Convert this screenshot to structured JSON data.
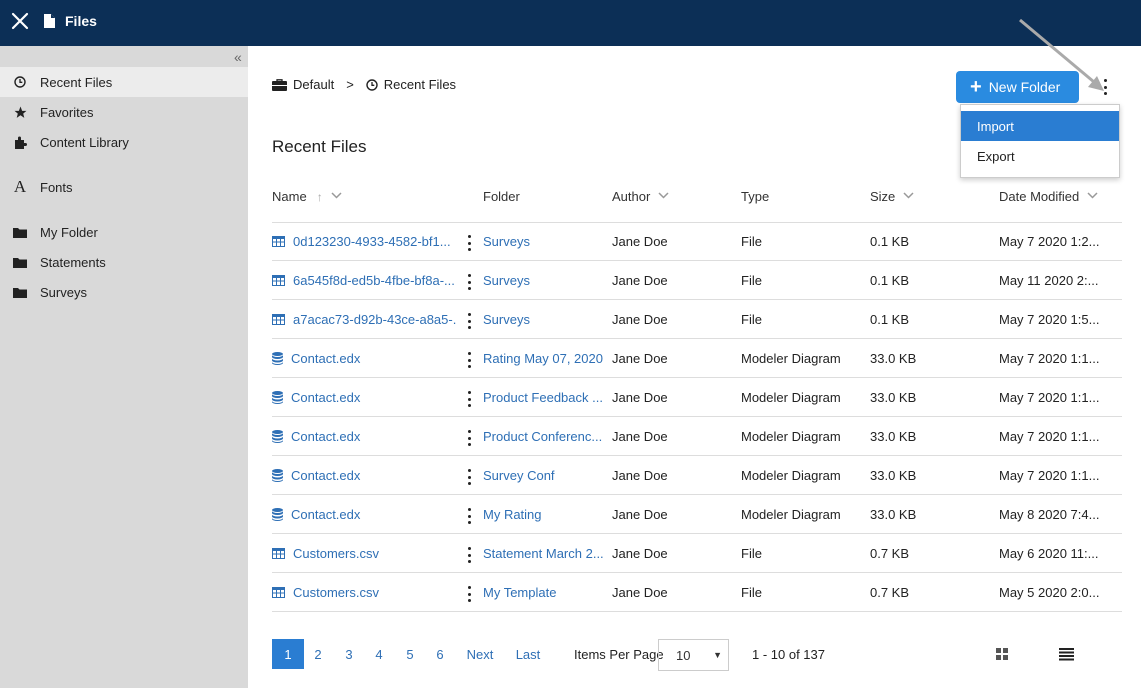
{
  "app": {
    "title": "Files"
  },
  "sidebar": {
    "collapse_label": "«",
    "items": [
      {
        "label": "Recent Files",
        "icon": "clock-icon"
      },
      {
        "label": "Favorites",
        "icon": "star-icon"
      },
      {
        "label": "Content Library",
        "icon": "puzzle-icon"
      },
      {
        "label": "Fonts",
        "icon": "font-icon"
      },
      {
        "label": "My Folder",
        "icon": "folder-icon"
      },
      {
        "label": "Statements",
        "icon": "folder-icon"
      },
      {
        "label": "Surveys",
        "icon": "folder-icon"
      }
    ]
  },
  "breadcrumb": {
    "root": "Default",
    "separator": ">",
    "current": "Recent Files"
  },
  "toolbar": {
    "new_folder_label": "New Folder"
  },
  "menu": {
    "items": [
      "Import",
      "Export"
    ]
  },
  "section_title": "Recent Files",
  "table": {
    "columns": [
      "Name",
      "Folder",
      "Author",
      "Type",
      "Size",
      "Date Modified"
    ],
    "rows": [
      {
        "icon": "table-icon",
        "name": "0d123230-4933-4582-bf1...",
        "folder": "Surveys",
        "author": "Jane Doe",
        "type": "File",
        "size": "0.1 KB",
        "date": "May 7 2020 1:2..."
      },
      {
        "icon": "table-icon",
        "name": "6a545f8d-ed5b-4fbe-bf8a-...",
        "folder": "Surveys",
        "author": "Jane Doe",
        "type": "File",
        "size": "0.1 KB",
        "date": "May 11 2020 2:..."
      },
      {
        "icon": "table-icon",
        "name": "a7acac73-d92b-43ce-a8a5-...",
        "folder": "Surveys",
        "author": "Jane Doe",
        "type": "File",
        "size": "0.1 KB",
        "date": "May 7 2020 1:5..."
      },
      {
        "icon": "database-icon",
        "name": "Contact.edx",
        "folder": "Rating May 07, 2020",
        "author": "Jane Doe",
        "type": "Modeler Diagram",
        "size": "33.0 KB",
        "date": "May 7 2020 1:1..."
      },
      {
        "icon": "database-icon",
        "name": "Contact.edx",
        "folder": "Product Feedback ...",
        "author": "Jane Doe",
        "type": "Modeler Diagram",
        "size": "33.0 KB",
        "date": "May 7 2020 1:1..."
      },
      {
        "icon": "database-icon",
        "name": "Contact.edx",
        "folder": "Product Conferenc...",
        "author": "Jane Doe",
        "type": "Modeler Diagram",
        "size": "33.0 KB",
        "date": "May 7 2020 1:1..."
      },
      {
        "icon": "database-icon",
        "name": "Contact.edx",
        "folder": "Survey Conf",
        "author": "Jane Doe",
        "type": "Modeler Diagram",
        "size": "33.0 KB",
        "date": "May 7 2020 1:1..."
      },
      {
        "icon": "database-icon",
        "name": "Contact.edx",
        "folder": "My Rating",
        "author": "Jane Doe",
        "type": "Modeler Diagram",
        "size": "33.0 KB",
        "date": "May 8 2020 7:4..."
      },
      {
        "icon": "table-icon",
        "name": "Customers.csv",
        "folder": "Statement March 2...",
        "author": "Jane Doe",
        "type": "File",
        "size": "0.7 KB",
        "date": "May 6 2020 11:..."
      },
      {
        "icon": "table-icon",
        "name": "Customers.csv",
        "folder": "My Template",
        "author": "Jane Doe",
        "type": "File",
        "size": "0.7 KB",
        "date": "May 5 2020 2:0..."
      }
    ]
  },
  "pagination": {
    "pages": [
      "1",
      "2",
      "3",
      "4",
      "5",
      "6"
    ],
    "current": "1",
    "next_label": "Next",
    "last_label": "Last",
    "items_per_page_label": "Items Per Page",
    "items_per_page_value": "10",
    "range_text": "1 - 10 of 137"
  },
  "colors": {
    "topbar": "#0c2f56",
    "accent": "#2a8be0",
    "link": "#2e6fb5",
    "sidebar": "#d9d9d9"
  }
}
